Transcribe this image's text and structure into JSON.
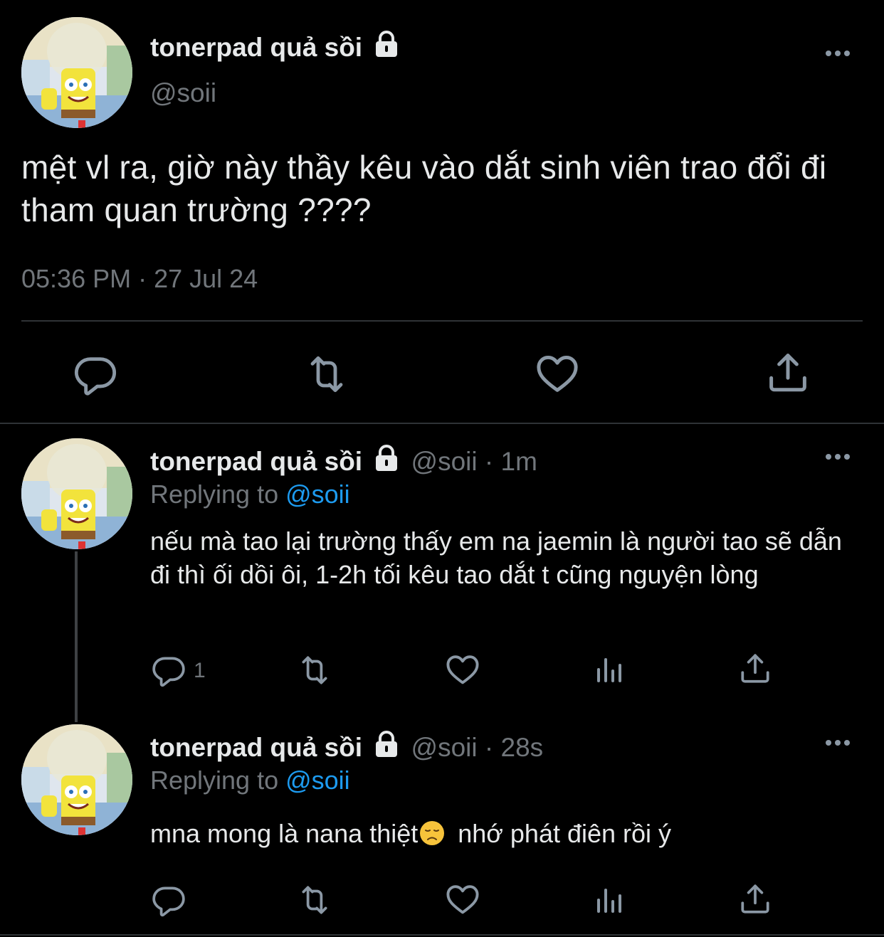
{
  "main_tweet": {
    "display_name": "tonerpad quả sồi",
    "handle": "@soii",
    "text": "mệt vl ra, giờ này thầy kêu vào dắt sinh viên trao đổi đi tham quan trường ????",
    "timestamp": "05:36 PM · 27 Jul 24"
  },
  "replies": [
    {
      "display_name": "tonerpad quả sồi",
      "handle_time": "@soii · 1m",
      "replying_prefix": "Replying to ",
      "replying_handle": "@soii",
      "text": "nếu mà tao lại trường thấy em na jaemin là người tao sẽ dẫn đi thì ối dồi ôi, 1-2h tối kêu tao dắt t cũng nguyện lòng",
      "reply_count": "1"
    },
    {
      "display_name": "tonerpad quả sồi",
      "handle_time": "@soii · 28s",
      "replying_prefix": "Replying to ",
      "replying_handle": "@soii",
      "text_before_emoji": "mna mong là nana thiệt",
      "text_after_emoji": "nhớ phát điên rồi ý",
      "reply_count": ""
    }
  ],
  "colors": {
    "background": "#000000",
    "text": "#e7e9ea",
    "secondary": "#71767b",
    "link": "#1d9bf0"
  },
  "icons": [
    "lock-icon",
    "more-icon",
    "reply-icon",
    "retweet-icon",
    "like-icon",
    "analytics-icon",
    "share-icon",
    "sad-face-emoji"
  ]
}
